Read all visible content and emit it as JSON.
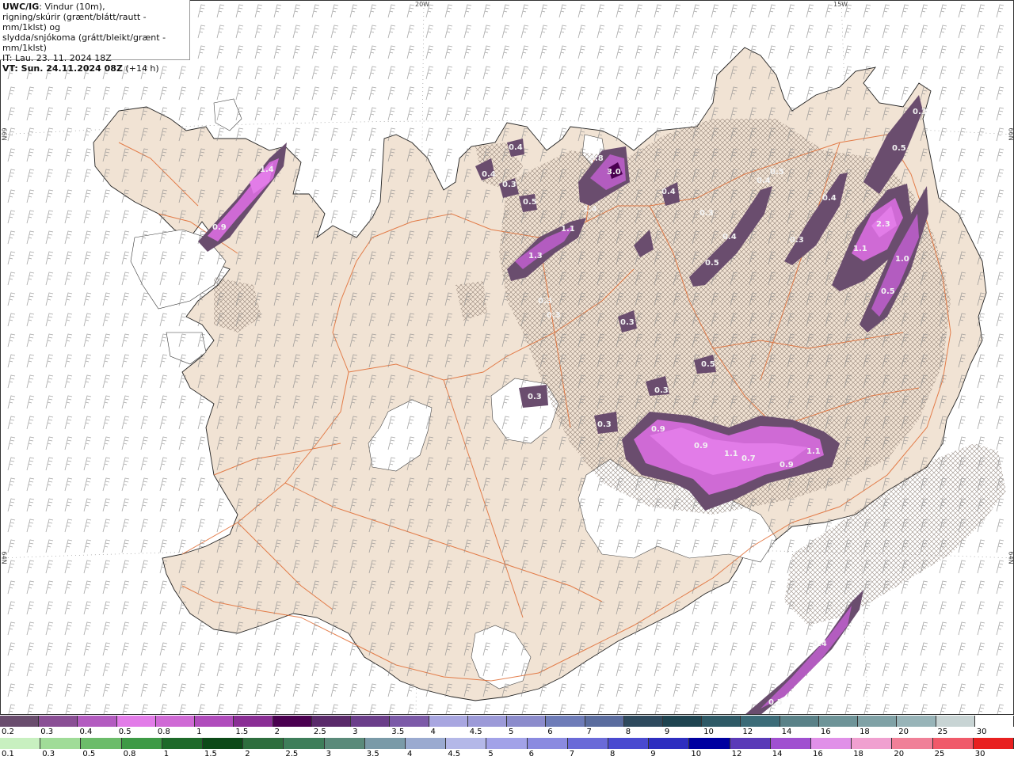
{
  "info": {
    "title": "UWC/IG",
    "title_rest": ": Vindur (10m),",
    "line2": "rigning/skúrir (grænt/blátt/rautt - mm/1klst) og",
    "line3": "slydda/snjókoma (grátt/bleikt/grænt - mm/1klst)",
    "it": "IT: Lau. 23. 11. 2024 18Z",
    "vt_bold": "VT: Sun. 24.11.2024 08Z",
    "vt_rest": " (+14 h)"
  },
  "coords": {
    "top_20w": "20W",
    "top_15w": "15W",
    "left_66n": "66N",
    "left_64n": "64N",
    "right_66n": "66N",
    "right_64n": "64N"
  },
  "precip_labels": [
    "1.4",
    "0.9",
    "0.4",
    "0.4",
    "0.3",
    "0.5",
    "0.8",
    "3.0",
    "1.4",
    "1.1",
    "1.3",
    "0.3",
    "0.3",
    "0.4",
    "0.3",
    "0.5",
    "0.4",
    "0.5",
    "0.4",
    "0.4",
    "0.3",
    "0.5",
    "2.3",
    "1.1",
    "1.0",
    "0.5",
    "0.3",
    "0.3",
    "0.3",
    "0.5",
    "0.3",
    "0.3",
    "0.9",
    "0.9",
    "1.1",
    "0.7",
    "0.9",
    "1.1",
    "0.4",
    "0.5"
  ],
  "legend_snow": {
    "labels": [
      "0.2",
      "0.3",
      "0.4",
      "0.5",
      "0.8",
      "1",
      "1.5",
      "2",
      "2.5",
      "3",
      "3.5",
      "4",
      "4.5",
      "5",
      "6",
      "7",
      "8",
      "9",
      "10",
      "12",
      "14",
      "16",
      "18",
      "20",
      "25",
      "30"
    ],
    "colors": [
      "#6a4d6e",
      "#8a4f95",
      "#b35cc0",
      "#e27ce8",
      "#cf6ad5",
      "#b04cbc",
      "#8a2e95",
      "#4a0050",
      "#5a2a6a",
      "#6b3e8a",
      "#7c5aa8",
      "#a8a6e0",
      "#9c9ad8",
      "#8c8ccc",
      "#6e7cb8",
      "#5a6c9e",
      "#2e4a5e",
      "#1e4450",
      "#2e5a66",
      "#3c6c78",
      "#5a8288",
      "#6e9498",
      "#80a2a6",
      "#98b4b8",
      "#c8d4d4",
      "#ffffff"
    ]
  },
  "legend_rain": {
    "labels": [
      "0.1",
      "0.3",
      "0.5",
      "0.8",
      "1",
      "1.5",
      "2",
      "2.5",
      "3",
      "3.5",
      "4",
      "4.5",
      "5",
      "6",
      "7",
      "8",
      "9",
      "10",
      "12",
      "14",
      "16",
      "18",
      "20",
      "25",
      "30"
    ],
    "colors": [
      "#c8f0c0",
      "#a0dc98",
      "#6cbc6a",
      "#3e9a46",
      "#1e6a2a",
      "#0c4a18",
      "#2e6e3e",
      "#3e7e5a",
      "#5a8a7a",
      "#7a9aa8",
      "#9aaad0",
      "#b4b8e8",
      "#a2a2e8",
      "#8a8ae0",
      "#6a6ad8",
      "#4a4ad0",
      "#2e2ec0",
      "#0000a0",
      "#5a3ab8",
      "#a050d0",
      "#e090e8",
      "#f0a0d0",
      "#f08098",
      "#f05a6a",
      "#e82020"
    ]
  }
}
